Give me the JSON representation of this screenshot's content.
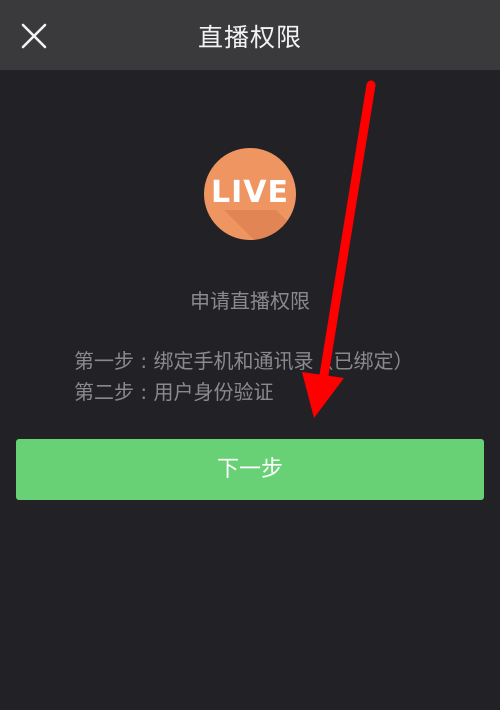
{
  "header": {
    "title": "直播权限",
    "close_icon": "close-icon"
  },
  "badge": {
    "text": "LIVE",
    "color": "#ee9561"
  },
  "main": {
    "apply_label": "申请直播权限",
    "steps": [
      "第一步 : 绑定手机和通讯录（已绑定）",
      "第二步 : 用户身份验证"
    ]
  },
  "actions": {
    "next_label": "下一步",
    "next_color": "#68d176"
  },
  "annotation": {
    "arrow_color": "#ff0000",
    "icon": "red-arrow-icon"
  }
}
